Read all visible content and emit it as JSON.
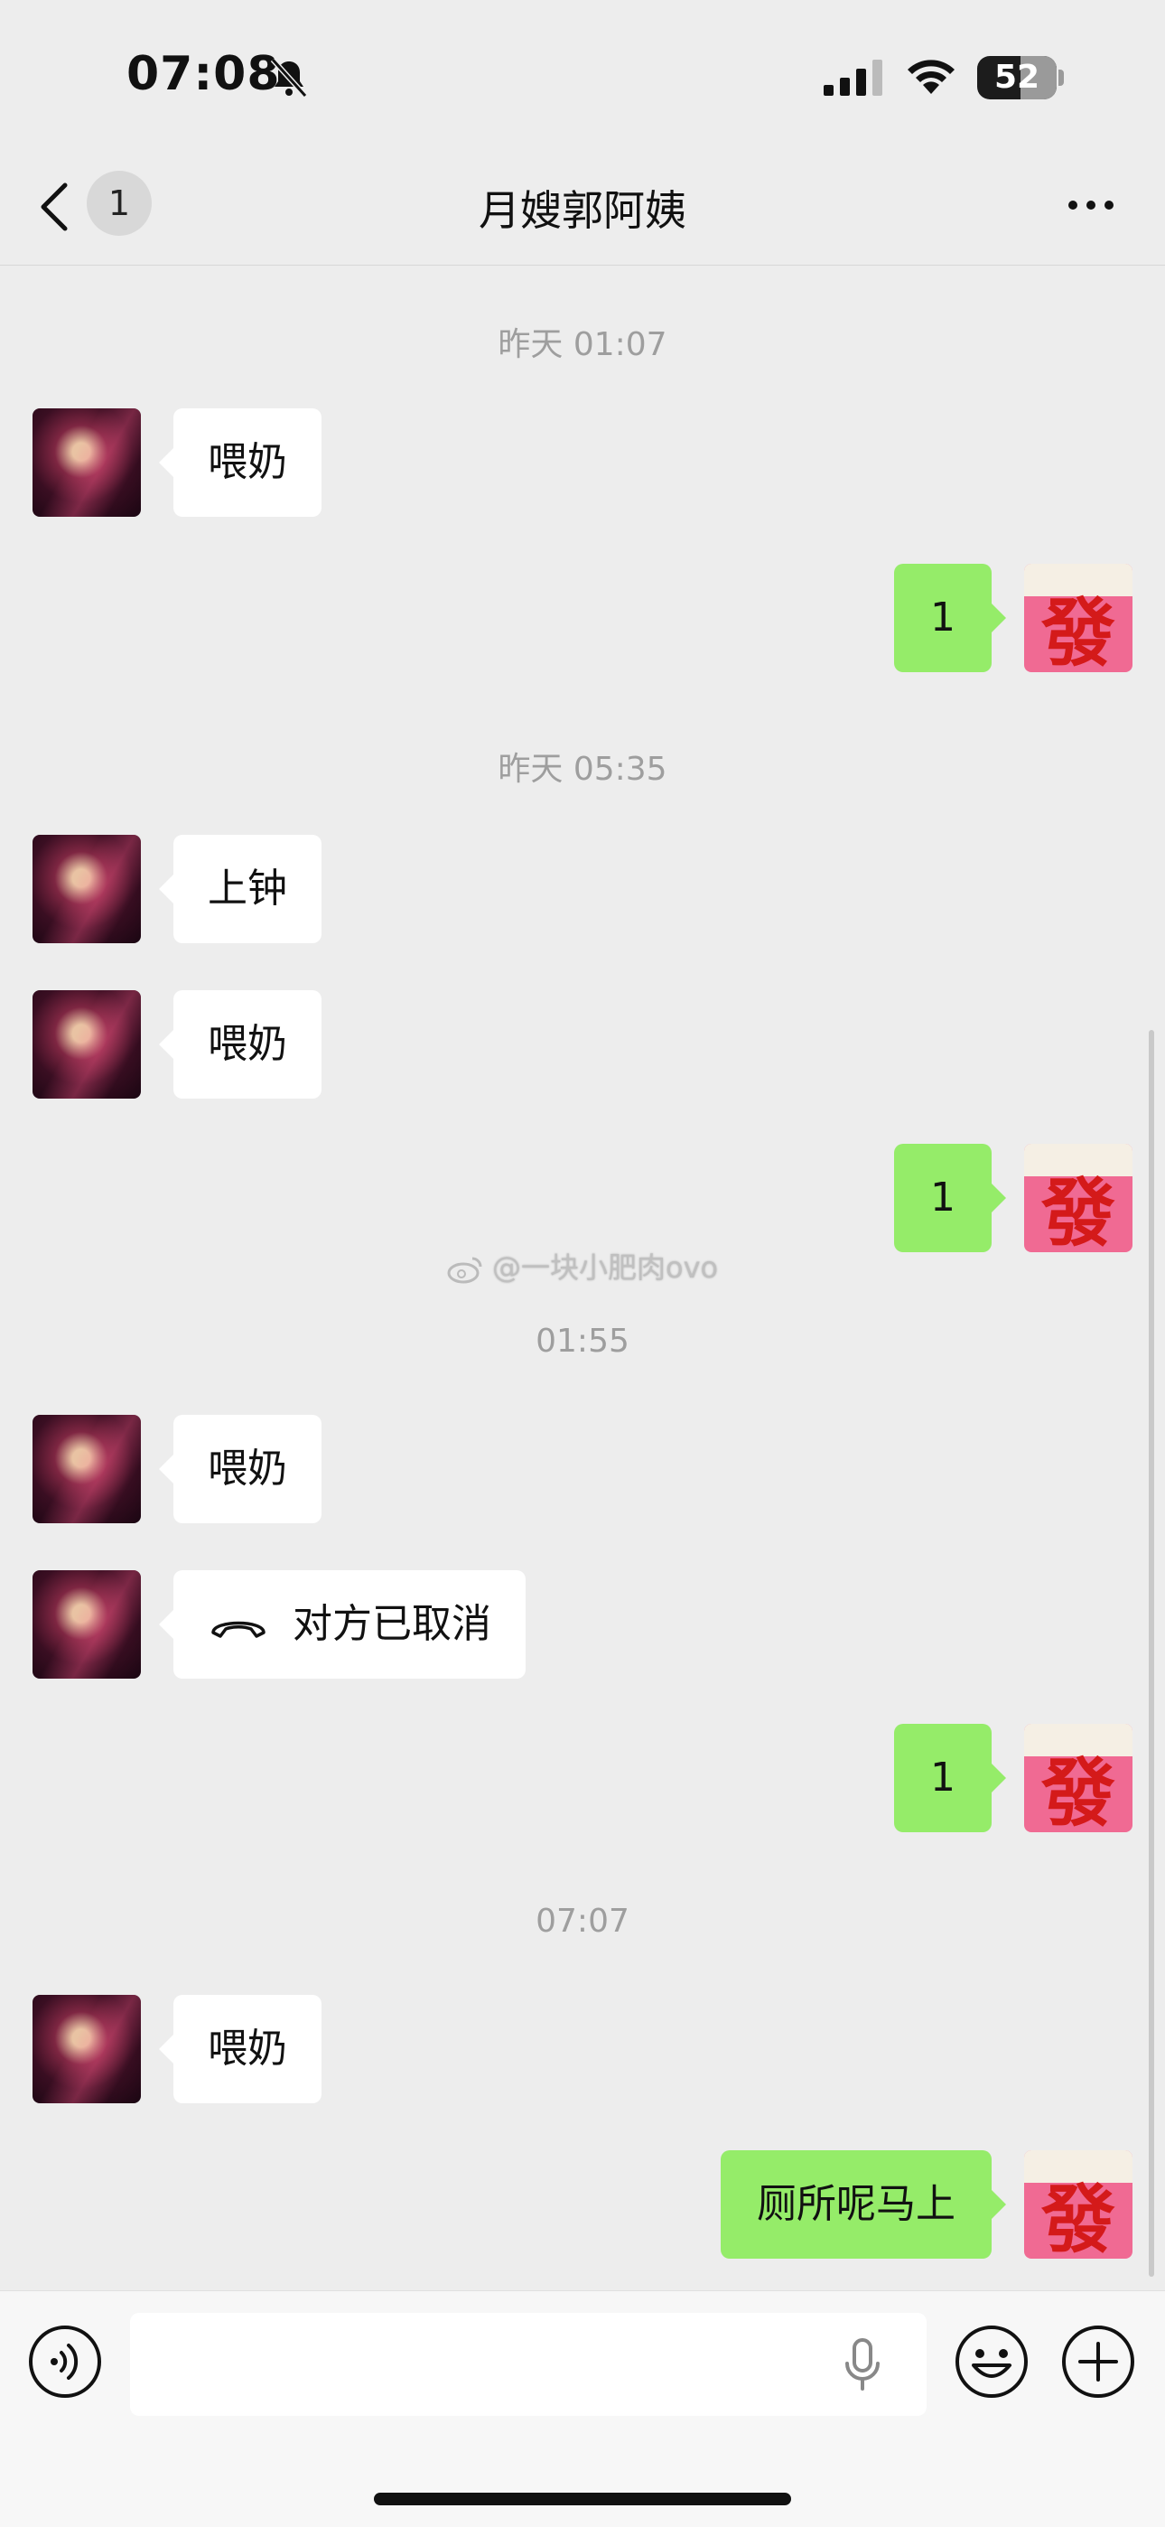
{
  "status": {
    "time": "07:08",
    "battery": "52"
  },
  "nav": {
    "unread": "1",
    "title": "月嫂郭阿姨"
  },
  "timestamps": [
    "昨天 01:07",
    "昨天 05:35",
    "01:55",
    "07:07"
  ],
  "watermark": "@一块小肥肉ovo",
  "messages": [
    {
      "side": "left",
      "text": "喂奶"
    },
    {
      "side": "right",
      "text": "1"
    },
    {
      "side": "left",
      "text": "上钟"
    },
    {
      "side": "left",
      "text": "喂奶"
    },
    {
      "side": "right",
      "text": "1"
    },
    {
      "side": "left",
      "text": "喂奶"
    },
    {
      "side": "left",
      "text": "对方已取消",
      "icon": "phone-hangup-icon"
    },
    {
      "side": "right",
      "text": "1"
    },
    {
      "side": "left",
      "text": "喂奶"
    },
    {
      "side": "right",
      "text": "厕所呢马上"
    }
  ],
  "avatar_right_char": "發",
  "input": {
    "value": "",
    "placeholder": ""
  },
  "colors": {
    "background": "#ededed",
    "bubble_mine": "#95ec69",
    "bubble_theirs": "#ffffff",
    "timestamp": "#9e9e9e"
  }
}
